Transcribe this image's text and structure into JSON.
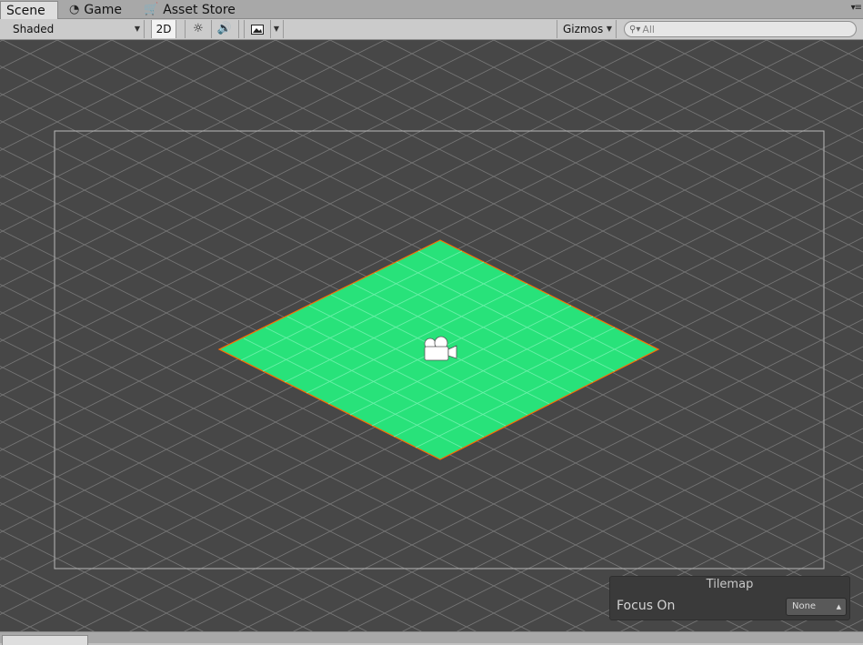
{
  "tabs": [
    {
      "label": "Scene",
      "icon": "scene-icon",
      "active": true
    },
    {
      "label": "Game",
      "icon": "game-icon",
      "active": false
    },
    {
      "label": "Asset Store",
      "icon": "store-icon",
      "active": false
    }
  ],
  "toolbar": {
    "draw_mode": "Shaded",
    "mode_2d_label": "2D",
    "lighting_icon": "sun-icon",
    "audio_icon": "speaker-icon",
    "effects_icon": "image-icon",
    "gizmos_label": "Gizmos",
    "search_placeholder": "All"
  },
  "scene": {
    "camera_icon": "camera-icon",
    "tile_color": "#28e27a",
    "tile_outline_color": "#ff6a00",
    "background_color": "#474747"
  },
  "tilemap_overlay": {
    "title": "Tilemap",
    "focus_label": "Focus On",
    "focus_value": "None"
  }
}
